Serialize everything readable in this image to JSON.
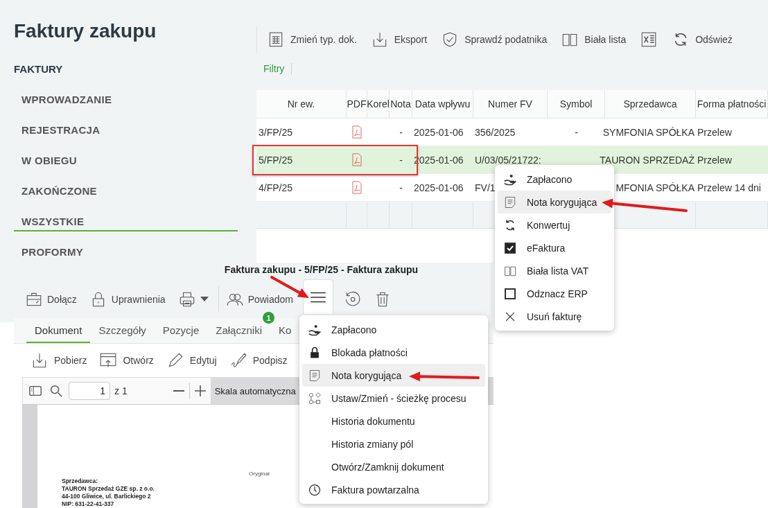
{
  "sidebar": {
    "title": "Faktury zakupu",
    "section": "FAKTURY",
    "items": [
      {
        "label": "WPROWADZANIE",
        "selected": false
      },
      {
        "label": "REJESTRACJA",
        "selected": false
      },
      {
        "label": "W OBIEGU",
        "selected": false
      },
      {
        "label": "ZAKOŃCZONE",
        "selected": false
      },
      {
        "label": "WSZYSTKIE",
        "selected": true
      },
      {
        "label": "PROFORMY",
        "selected": false
      }
    ]
  },
  "toolbar": [
    {
      "label": "Zmień typ. dok.",
      "kind": "sheet"
    },
    {
      "label": "Eksport",
      "kind": "export"
    },
    {
      "label": "Sprawdź podatnika",
      "kind": "shield"
    },
    {
      "label": "Biała lista",
      "kind": "book"
    },
    {
      "kind": "excel"
    },
    {
      "label": "Odśwież",
      "kind": "refresh"
    }
  ],
  "filters": "Filtry",
  "table": {
    "columns": [
      {
        "label": "Nr ew.",
        "kind": "text"
      },
      {
        "label": "PDF",
        "kind": "icon"
      },
      {
        "label": "Korel"
      },
      {
        "label": "Nota",
        "kind": "text"
      },
      {
        "label": "Data wpływu",
        "kind": "text"
      },
      {
        "label": "Numer FV",
        "kind": "text"
      },
      {
        "label": "Symbol",
        "kind": "text"
      },
      {
        "label": "Sprzedawca",
        "kind": "right"
      },
      {
        "label": "Forma płatności",
        "kind": "text"
      }
    ],
    "rows": [
      {
        "selected": false,
        "cells": [
          "3/FP/25",
          true,
          null,
          "-",
          "2025-01-06",
          "356/2025",
          "-",
          "SYMFONIA SPÓŁKA",
          "Przelew"
        ]
      },
      {
        "selected": true,
        "cells": [
          "5/FP/25",
          true,
          null,
          "-",
          "2025-01-06",
          "U/03/05/21722:",
          null,
          "TAURON SPRZEDAŻ",
          "Przelew"
        ]
      },
      {
        "selected": false,
        "cells": [
          "4/FP/25",
          true,
          null,
          "-",
          "2025-01-06",
          "FV/1",
          null,
          "MFONIA SPÓŁKA",
          "Przelew 14 dni"
        ]
      }
    ]
  },
  "context_menu": {
    "items": [
      {
        "kind": "hand",
        "label": "Zapłacono",
        "selected": false
      },
      {
        "kind": "note",
        "label": "Nota korygująca",
        "selected": true
      },
      {
        "kind": "convert",
        "label": "Konwertuj",
        "selected": false
      },
      {
        "kind": "checkbox",
        "checked": true,
        "label": "eFaktura",
        "selected": false
      },
      {
        "kind": "book",
        "label": "Biała lista VAT",
        "selected": false
      },
      {
        "kind": "checkbox",
        "checked": false,
        "label": "Odznacz ERP",
        "selected": false
      },
      {
        "kind": "close",
        "label": "Usuń fakturę",
        "selected": false
      }
    ]
  },
  "detail_window": {
    "title": "Faktura zakupu - 5/FP/25 - Faktura zakupu",
    "toolbar": [
      {
        "label": "Dołącz",
        "kind": "briefcase",
        "pressed": false
      },
      {
        "label": "Uprawnienia",
        "kind": "lock",
        "pressed": false
      },
      {
        "kind": "printer",
        "dropdown": true,
        "pressed": false
      },
      {
        "label": "Powiadom",
        "kind": "people",
        "pressed": false
      },
      {
        "kind": "menu",
        "pressed": true
      },
      {
        "kind": "rotate",
        "pressed": false
      },
      {
        "kind": "trash",
        "pressed": false
      }
    ],
    "tabs": [
      {
        "label": "Dokument",
        "selected": true
      },
      {
        "label": "Szczegóły",
        "selected": false
      },
      {
        "label": "Pozycje",
        "selected": false
      },
      {
        "label": "Załączniki",
        "selected": false,
        "badge": "1"
      },
      {
        "label": "Ko",
        "selected": false
      }
    ],
    "doc_toolbar": [
      {
        "label": "Pobierz",
        "kind": "download"
      },
      {
        "label": "Otwórz",
        "kind": "window"
      },
      {
        "label": "Edytuj",
        "kind": "pencil"
      },
      {
        "label": "Podpisz",
        "kind": "sign"
      }
    ],
    "pdf_toolbar": {
      "page": "1",
      "page_count": "z 1",
      "zoom": "Skala automatyczna"
    },
    "document": {
      "stamp": "Oryginał",
      "lines": [
        "Sprzedawca:",
        "TAURON Sprzedaż GZE sp. z o.o.",
        "44-100 Gliwice, ul. Barlickiego 2",
        "NIP: 631-22-41-337"
      ]
    },
    "menu": {
      "items": [
        {
          "kind": "hand",
          "label": "Zapłacono",
          "selected": false
        },
        {
          "kind": "lock-solid",
          "label": "Blokada płatności",
          "selected": false
        },
        {
          "kind": "note",
          "label": "Nota korygująca",
          "selected": true
        },
        {
          "kind": "process",
          "label": "Ustaw/Zmień - ścieżkę procesu",
          "selected": false
        },
        {
          "kind": "plain",
          "label": "Historia dokumentu",
          "selected": false
        },
        {
          "kind": "plain",
          "label": "Historia zmiany pól",
          "selected": false
        },
        {
          "kind": "plain",
          "label": "Otwórz/Zamknij dokument",
          "selected": false
        },
        {
          "kind": "clock",
          "label": "Faktura powtarzalna",
          "selected": false
        }
      ]
    }
  }
}
